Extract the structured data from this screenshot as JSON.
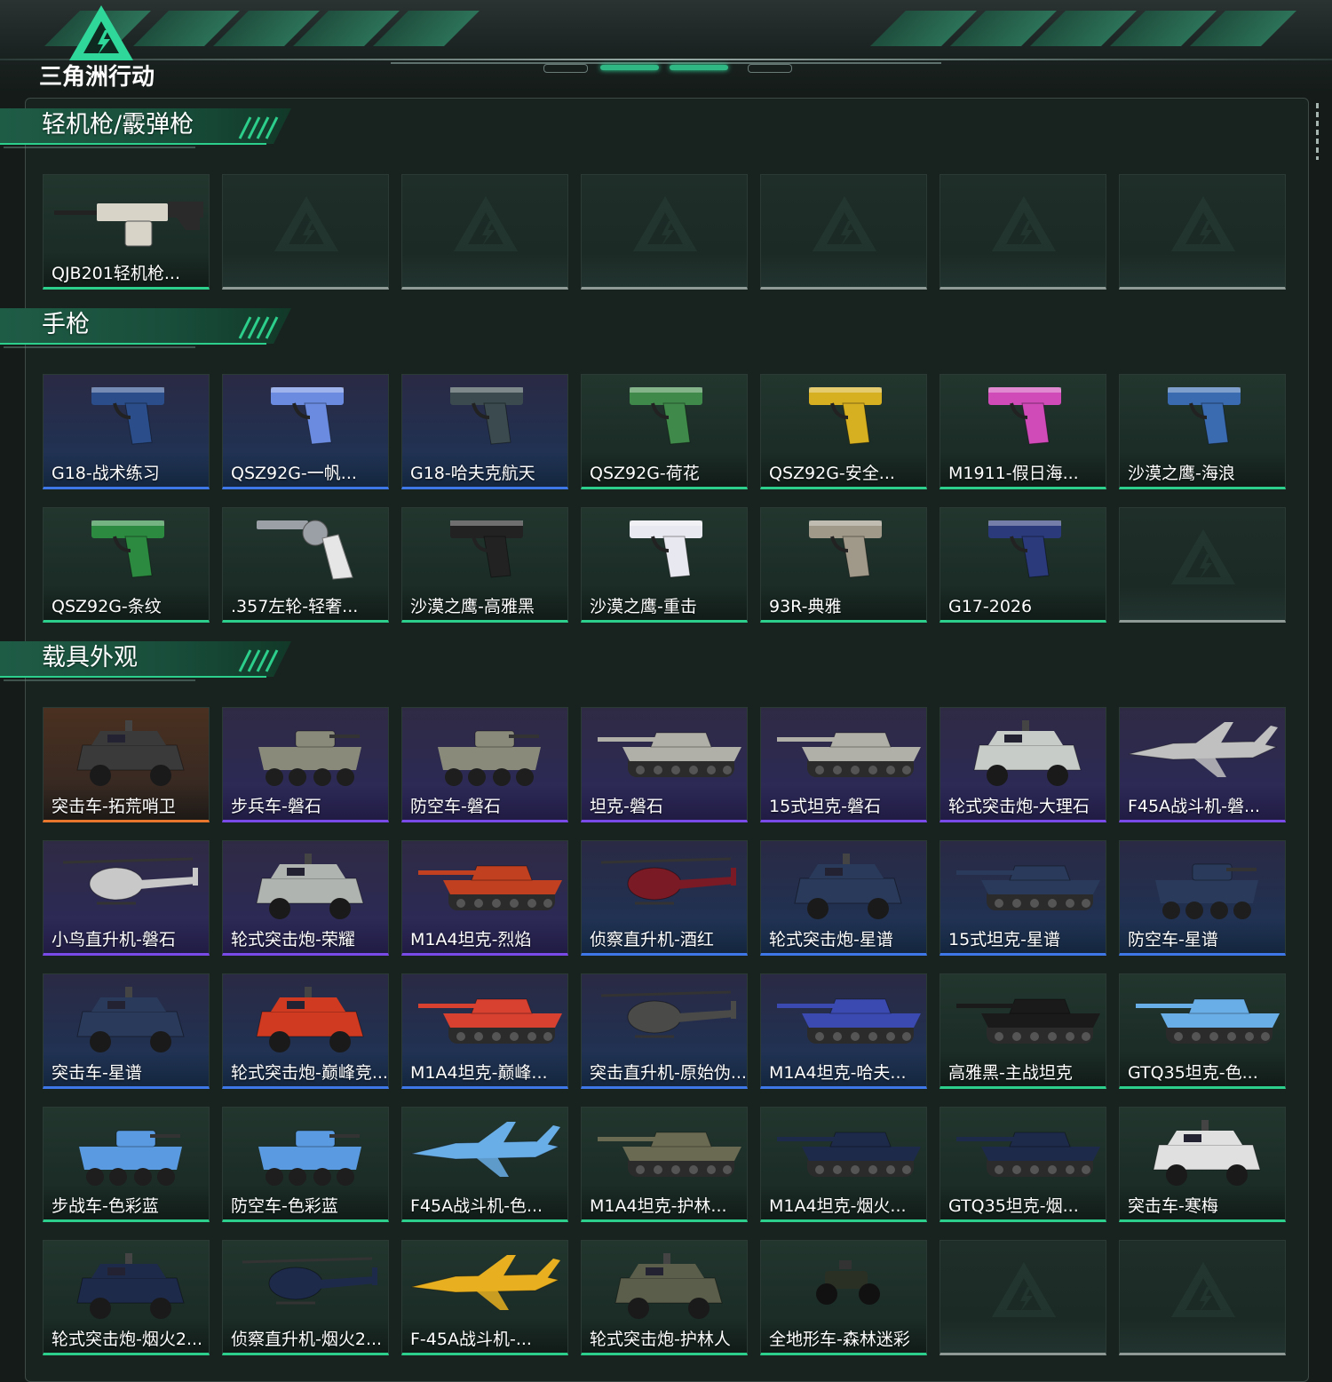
{
  "app": {
    "logo_text": "三角洲行动",
    "accent_color": "#2dcf8c"
  },
  "sections": [
    {
      "title": "轻机枪/霰弹枪",
      "cards": [
        {
          "name": "QJB201轻机枪...",
          "rarity": "green",
          "icon": "machine-gun-icon"
        },
        {
          "name": "",
          "rarity": "empty",
          "icon": "placeholder-logo-icon"
        },
        {
          "name": "",
          "rarity": "empty",
          "icon": "placeholder-logo-icon"
        },
        {
          "name": "",
          "rarity": "empty",
          "icon": "placeholder-logo-icon"
        },
        {
          "name": "",
          "rarity": "empty",
          "icon": "placeholder-logo-icon"
        },
        {
          "name": "",
          "rarity": "empty",
          "icon": "placeholder-logo-icon"
        },
        {
          "name": "",
          "rarity": "empty",
          "icon": "placeholder-logo-icon"
        }
      ]
    },
    {
      "title": "手枪",
      "cards": [
        {
          "name": "G18-战术练习",
          "rarity": "blue",
          "icon": "pistol-icon",
          "tint": "#2b4e8a"
        },
        {
          "name": "QSZ92G-一帆...",
          "rarity": "blue",
          "icon": "pistol-icon",
          "tint": "#6a8be0"
        },
        {
          "name": "G18-哈夫克航天",
          "rarity": "blue",
          "icon": "pistol-icon",
          "tint": "#3a4a4e"
        },
        {
          "name": "QSZ92G-荷花",
          "rarity": "green",
          "icon": "pistol-icon",
          "tint": "#3f8a4a"
        },
        {
          "name": "QSZ92G-安全...",
          "rarity": "green",
          "icon": "pistol-icon",
          "tint": "#d6b020"
        },
        {
          "name": "M1911-假日海...",
          "rarity": "green",
          "icon": "pistol-icon",
          "tint": "#d04ab8"
        },
        {
          "name": "沙漠之鹰-海浪",
          "rarity": "green",
          "icon": "pistol-icon",
          "tint": "#3a6ab0"
        },
        {
          "name": "QSZ92G-条纹",
          "rarity": "green",
          "icon": "pistol-icon",
          "tint": "#2c8a40"
        },
        {
          "name": ".357左轮-轻奢...",
          "rarity": "green",
          "icon": "revolver-icon",
          "tint": "#9aa0a6"
        },
        {
          "name": "沙漠之鹰-高雅黑",
          "rarity": "green",
          "icon": "pistol-icon",
          "tint": "#222222"
        },
        {
          "name": "沙漠之鹰-重击",
          "rarity": "green",
          "icon": "pistol-icon",
          "tint": "#e8e8f0"
        },
        {
          "name": "93R-典雅",
          "rarity": "green",
          "icon": "pistol-icon",
          "tint": "#a09888"
        },
        {
          "name": "G17-2026",
          "rarity": "green",
          "icon": "pistol-icon",
          "tint": "#2a3a7a"
        },
        {
          "name": "",
          "rarity": "empty",
          "icon": "placeholder-logo-icon"
        }
      ]
    },
    {
      "title": "载具外观",
      "cards": [
        {
          "name": "突击车-拓荒哨卫",
          "rarity": "orange",
          "icon": "armored-car-icon",
          "tint": "#3a3a3a"
        },
        {
          "name": "步兵车-磐石",
          "rarity": "purple",
          "icon": "ifv-icon",
          "tint": "#8a8a7a"
        },
        {
          "name": "防空车-磐石",
          "rarity": "purple",
          "icon": "ifv-icon",
          "tint": "#8a8a7a"
        },
        {
          "name": "坦克-磐石",
          "rarity": "purple",
          "icon": "tank-icon",
          "tint": "#b0b0a8"
        },
        {
          "name": "15式坦克-磐石",
          "rarity": "purple",
          "icon": "tank-icon",
          "tint": "#b0b0a8"
        },
        {
          "name": "轮式突击炮-大理石",
          "rarity": "purple",
          "icon": "armored-car-icon",
          "tint": "#c8ccc8"
        },
        {
          "name": "F45A战斗机-磐...",
          "rarity": "purple",
          "icon": "jet-icon",
          "tint": "#c0c0c0"
        },
        {
          "name": "小鸟直升机-磐石",
          "rarity": "purple",
          "icon": "helicopter-icon",
          "tint": "#c8c8c8"
        },
        {
          "name": "轮式突击炮-荣耀",
          "rarity": "purple",
          "icon": "armored-car-icon",
          "tint": "#b0b4b0"
        },
        {
          "name": "M1A4坦克-烈焰",
          "rarity": "purple",
          "icon": "tank-icon",
          "tint": "#c04020"
        },
        {
          "name": "侦察直升机-酒红",
          "rarity": "blue",
          "icon": "helicopter-icon",
          "tint": "#7a1a24"
        },
        {
          "name": "轮式突击炮-星谱",
          "rarity": "blue",
          "icon": "armored-car-icon",
          "tint": "#2a3a5a"
        },
        {
          "name": "15式坦克-星谱",
          "rarity": "blue",
          "icon": "tank-icon",
          "tint": "#2a3a5a"
        },
        {
          "name": "防空车-星谱",
          "rarity": "blue",
          "icon": "ifv-icon",
          "tint": "#2a3a5a"
        },
        {
          "name": "突击车-星谱",
          "rarity": "blue",
          "icon": "armored-car-icon",
          "tint": "#2a3a5a"
        },
        {
          "name": "轮式突击炮-巅峰竞...",
          "rarity": "blue",
          "icon": "armored-car-icon",
          "tint": "#d03a20"
        },
        {
          "name": "M1A4坦克-巅峰...",
          "rarity": "blue",
          "icon": "tank-icon",
          "tint": "#d84030"
        },
        {
          "name": "突击直升机-原始伪...",
          "rarity": "blue",
          "icon": "helicopter-icon",
          "tint": "#4a4a48"
        },
        {
          "name": "M1A4坦克-哈夫...",
          "rarity": "blue",
          "icon": "tank-icon",
          "tint": "#3a4ab0"
        },
        {
          "name": "高雅黑-主战坦克",
          "rarity": "green",
          "icon": "tank-icon",
          "tint": "#1a1a1a"
        },
        {
          "name": "GTQ35坦克-色...",
          "rarity": "green",
          "icon": "tank-icon",
          "tint": "#6aaee8"
        },
        {
          "name": "步战车-色彩蓝",
          "rarity": "green",
          "icon": "ifv-icon",
          "tint": "#5a9ae0"
        },
        {
          "name": "防空车-色彩蓝",
          "rarity": "green",
          "icon": "ifv-icon",
          "tint": "#5a9ae0"
        },
        {
          "name": "F45A战斗机-色...",
          "rarity": "green",
          "icon": "jet-icon",
          "tint": "#6aaee8"
        },
        {
          "name": "M1A4坦克-护林...",
          "rarity": "green",
          "icon": "tank-icon",
          "tint": "#6a6a52"
        },
        {
          "name": "M1A4坦克-烟火...",
          "rarity": "green",
          "icon": "tank-icon",
          "tint": "#1e2a4a"
        },
        {
          "name": "GTQ35坦克-烟...",
          "rarity": "green",
          "icon": "tank-icon",
          "tint": "#1e2a4a"
        },
        {
          "name": "突击车-寒梅",
          "rarity": "green",
          "icon": "armored-car-icon",
          "tint": "#e0e0e0"
        },
        {
          "name": "轮式突击炮-烟火2...",
          "rarity": "green",
          "icon": "armored-car-icon",
          "tint": "#1e2a4a"
        },
        {
          "name": "侦察直升机-烟火2...",
          "rarity": "green",
          "icon": "helicopter-icon",
          "tint": "#1e2a4a"
        },
        {
          "name": "F-45A战斗机-...",
          "rarity": "green",
          "icon": "jet-icon",
          "tint": "#e8b020"
        },
        {
          "name": "轮式突击炮-护林人",
          "rarity": "green",
          "icon": "armored-car-icon",
          "tint": "#5a5e4a"
        },
        {
          "name": "全地形车-森林迷彩",
          "rarity": "green",
          "icon": "atv-icon",
          "tint": "#2a3024"
        },
        {
          "name": "",
          "rarity": "empty",
          "icon": "placeholder-logo-icon"
        },
        {
          "name": "",
          "rarity": "empty",
          "icon": "placeholder-logo-icon"
        }
      ]
    }
  ]
}
